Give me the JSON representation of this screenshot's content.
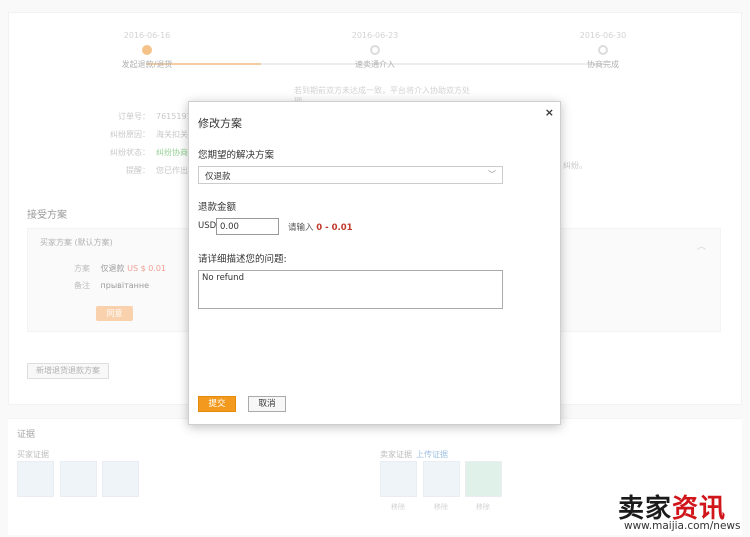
{
  "steps": [
    {
      "date": "2016-06-16",
      "label": "发起退款/退货"
    },
    {
      "date": "2016-06-23",
      "label": "速卖通介入"
    },
    {
      "date": "2016-06-30",
      "label": "协商完成"
    }
  ],
  "step_note": "若到期前双方未达成一致，平台将介入协助双方处理",
  "order_info": {
    "order_no_label": "订单号：",
    "order_no_value": "7615191",
    "reason_label": "纠纷原因：",
    "reason_value": "海关扣关",
    "status_label": "纠纷状态：",
    "status_value": "纠纷协商",
    "reminder_label": "提醒：",
    "reminder_value": "您已作出",
    "reminder_tail": "纠纷。"
  },
  "accept_section": {
    "title": "接受方案",
    "proposal_title": "买家方案 (默认方案)",
    "plan_label": "方案",
    "plan_value": "仅退款",
    "plan_amount": "US $ 0.01",
    "note_label": "备注",
    "note_value": "прывітанне",
    "agree_label": "同意"
  },
  "new_button": "新增退货退款方案",
  "evidence": {
    "title": "证据",
    "buyer_label": "买家证据",
    "seller_label": "卖家证据",
    "upload_link": "上传证据",
    "caption": "移除"
  },
  "modal": {
    "title": "修改方案",
    "close_symbol": "×",
    "solution_label": "您期望的解决方案",
    "solution_value": "仅退款",
    "amount_label": "退款金额",
    "currency": "USD",
    "amount_value": "0.00",
    "hint_prefix": "请输入",
    "hint_range": "0 - 0.01",
    "description_label": "请详细描述您的问题:",
    "description_value": "No refund",
    "submit_label": "提交",
    "cancel_label": "取消"
  },
  "watermark": {
    "logo_black": "卖家",
    "logo_red": "资讯",
    "url": "www.maijia.com/news"
  },
  "colors": {
    "accent": "#f39a1e",
    "range_red": "#c0392b",
    "status_green": "#5cb85c",
    "link_blue": "#6a9fd4"
  }
}
